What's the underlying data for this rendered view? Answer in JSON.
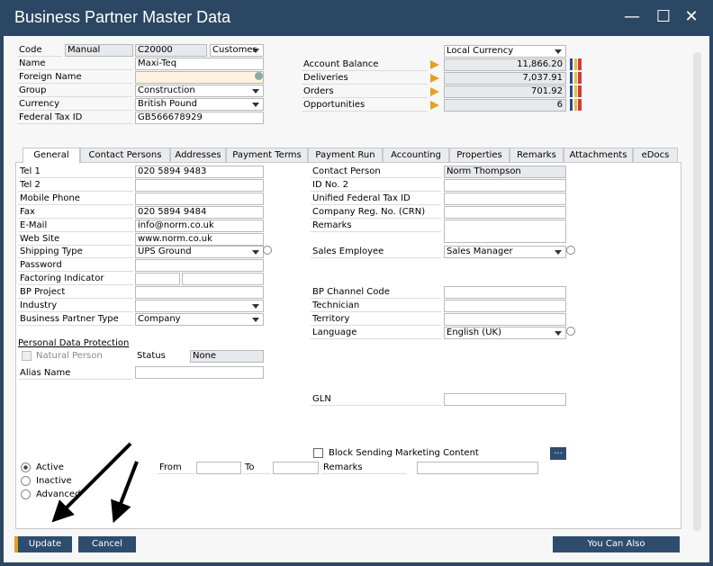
{
  "window": {
    "title": "Business Partner Master Data",
    "min": "—",
    "max": "☐",
    "close": "✕"
  },
  "header": {
    "code_label": "Code",
    "series": "Manual",
    "code": "C20000",
    "type": "Customer",
    "name_label": "Name",
    "name": "Maxi-Teq",
    "foreign_label": "Foreign Name",
    "foreign": "",
    "group_label": "Group",
    "group": "Construction",
    "currency_label": "Currency",
    "currency": "British Pound",
    "taxid_label": "Federal Tax ID",
    "taxid": "GB566678929",
    "currency_view": "Local Currency",
    "balances": [
      {
        "label": "Account Balance",
        "value": "11,866.20"
      },
      {
        "label": "Deliveries",
        "value": "7,037.91"
      },
      {
        "label": "Orders",
        "value": "701.92"
      },
      {
        "label": "Opportunities",
        "value": "6"
      }
    ]
  },
  "tabs": [
    "General",
    "Contact Persons",
    "Addresses",
    "Payment Terms",
    "Payment Run",
    "Accounting",
    "Properties",
    "Remarks",
    "Attachments",
    "eDocs"
  ],
  "general": {
    "left": [
      {
        "label": "Tel 1",
        "value": "020 5894 9483"
      },
      {
        "label": "Tel 2",
        "value": ""
      },
      {
        "label": "Mobile Phone",
        "value": ""
      },
      {
        "label": "Fax",
        "value": "020 5894 9484"
      },
      {
        "label": "E-Mail",
        "value": "info@norm.co.uk"
      },
      {
        "label": "Web Site",
        "value": "www.norm.co.uk"
      },
      {
        "label": "Shipping Type",
        "value": "UPS Ground"
      },
      {
        "label": "Password",
        "value": ""
      },
      {
        "label": "Factoring Indicator",
        "value": ""
      },
      {
        "label": "BP Project",
        "value": ""
      },
      {
        "label": "Industry",
        "value": ""
      },
      {
        "label": "Business Partner Type",
        "value": "Company"
      }
    ],
    "right": [
      {
        "label": "Contact Person",
        "value": "Norm Thompson"
      },
      {
        "label": "ID No. 2",
        "value": ""
      },
      {
        "label": "Unified Federal Tax ID",
        "value": ""
      },
      {
        "label": "Company Reg. No. (CRN)",
        "value": ""
      },
      {
        "label": "Remarks",
        "value": ""
      },
      {
        "label": "Sales Employee",
        "value": "Sales Manager"
      },
      {
        "label": "BP Channel Code",
        "value": ""
      },
      {
        "label": "Technician",
        "value": ""
      },
      {
        "label": "Territory",
        "value": ""
      },
      {
        "label": "Language",
        "value": "English (UK)"
      },
      {
        "label": "GLN",
        "value": ""
      }
    ],
    "pdp_title": "Personal Data Protection",
    "natural_person": "Natural Person",
    "status_label": "Status",
    "status": "None",
    "alias_label": "Alias Name",
    "alias": "",
    "block_marketing": "Block Sending Marketing Content",
    "more_button": "...",
    "radios": [
      "Active",
      "Inactive",
      "Advanced"
    ],
    "selected_radio": "Active",
    "from_label": "From",
    "from": "",
    "to_label": "To",
    "to": "",
    "remarks_label": "Remarks",
    "remarks": ""
  },
  "footer": {
    "update": "Update",
    "cancel": "Cancel",
    "you_can_also": "You Can Also"
  }
}
